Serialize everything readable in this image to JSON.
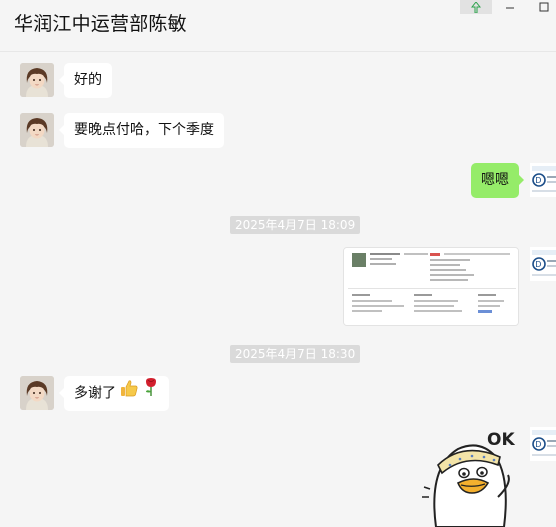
{
  "header": {
    "title": "华润江中运营部陈敏",
    "pin_icon": "pin-icon",
    "minimize_icon": "minimize-icon",
    "maximize_icon": "maximize-icon"
  },
  "messages": [
    {
      "type": "text",
      "side": "left",
      "text": "好的"
    },
    {
      "type": "text",
      "side": "left",
      "text": "要晚点付哈，下个季度"
    },
    {
      "type": "text",
      "side": "right",
      "text": "嗯嗯"
    },
    {
      "type": "timestamp",
      "text": "2025年4月7日 18:09"
    },
    {
      "type": "image",
      "side": "right",
      "description_icon": "document-screenshot-image"
    },
    {
      "type": "timestamp",
      "text": "2025年4月7日 18:30"
    },
    {
      "type": "text",
      "side": "left",
      "text": "多谢了",
      "emojis": [
        "thumbs-up-icon",
        "rose-icon"
      ]
    },
    {
      "type": "sticker",
      "side": "right",
      "sticker_text": "OK",
      "icon": "duck-ok-sticker"
    }
  ],
  "colors": {
    "background": "#f5f5f5",
    "bubble_left": "#ffffff",
    "bubble_right": "#95ec69",
    "timestamp_bg": "#dadada",
    "timestamp_text": "#ffffff"
  }
}
